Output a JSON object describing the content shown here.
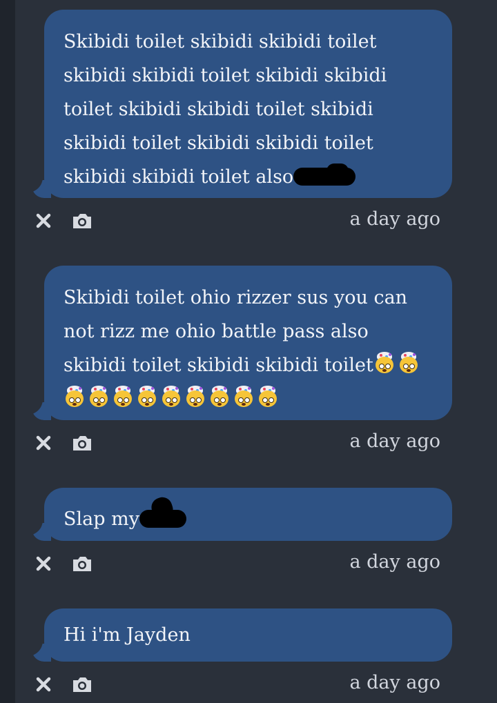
{
  "messages": [
    {
      "text": "Skibidi toilet skibidi skibidi toilet skibidi skibidi toilet skibidi skibidi toilet skibidi skibidi toilet skibidi skibidi toilet skibidi skibidi toilet skibidi skibidi toilet also",
      "redacted": true,
      "timestamp": "a day ago"
    },
    {
      "text": "Skibidi toilet ohio rizzer sus you can not rizz me ohio battle pass also skibidi toilet skibidi skibidi toilet",
      "emoji_count": 11,
      "emoji_name": "exploding-head-emoji",
      "timestamp": "a day ago"
    },
    {
      "text": "Slap my",
      "redacted": true,
      "timestamp": "a day ago"
    },
    {
      "text": "Hi i'm Jayden",
      "timestamp": "a day ago"
    }
  ],
  "icons": {
    "delete": "close-icon",
    "capture": "camera-icon"
  },
  "colors": {
    "bubble": "#2e5284",
    "background": "#2a303a",
    "text": "#f2f4f8",
    "timestamp": "#d2d6de",
    "icon": "#d8dbe1"
  }
}
